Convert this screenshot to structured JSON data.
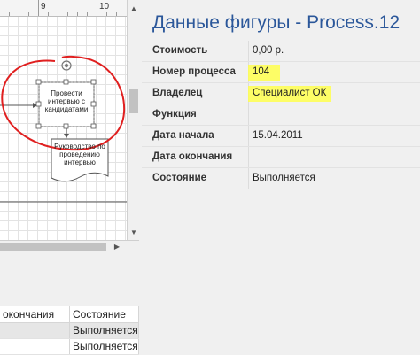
{
  "ruler": {
    "labels": [
      "9",
      "10"
    ]
  },
  "diagram": {
    "process_shape_text": "Провести интервью с кандидатами",
    "document_shape_text": "Руководство по проведению интервью"
  },
  "grid": {
    "headers": [
      "окончания",
      "Состояние"
    ],
    "rows": [
      {
        "col1": "",
        "col2": "Выполняется"
      },
      {
        "col1": "",
        "col2": "Выполняется"
      }
    ]
  },
  "shape_data": {
    "title": "Данные фигуры - Process.12",
    "rows": [
      {
        "label": "Стоимость",
        "value": "0,00 р."
      },
      {
        "label": "Номер процесса",
        "value": "104"
      },
      {
        "label": "Владелец",
        "value": "Специалист ОК"
      },
      {
        "label": "Функция",
        "value": ""
      },
      {
        "label": "Дата начала",
        "value": "15.04.2011"
      },
      {
        "label": "Дата окончания",
        "value": ""
      },
      {
        "label": "Состояние",
        "value": "Выполняется"
      }
    ]
  },
  "colors": {
    "title": "#2b579a",
    "highlight": "#ffff4d",
    "annotation": "#e02020"
  }
}
